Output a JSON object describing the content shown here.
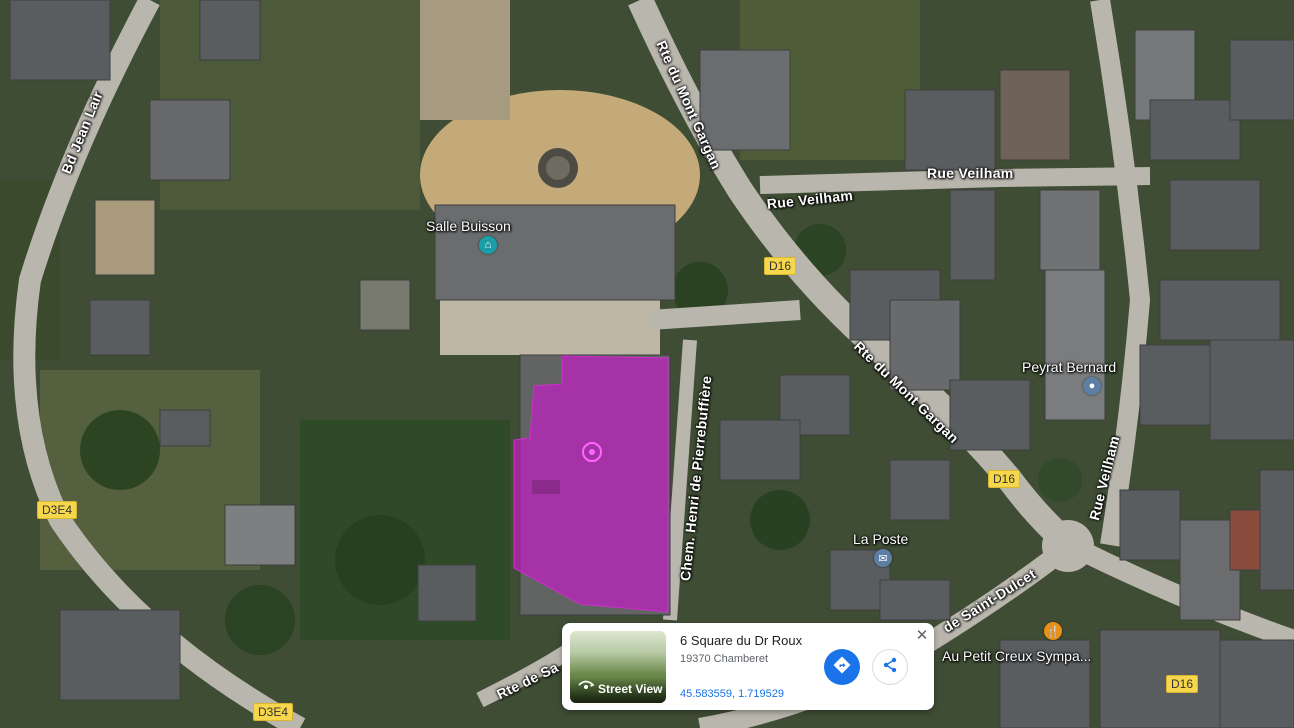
{
  "map": {
    "places": {
      "salle_buisson": "Salle Buisson",
      "peyrat_bernard": "Peyrat Bernard",
      "la_poste": "La Poste",
      "petit_creux": "Au Petit Creux Sympa..."
    },
    "roads": {
      "bd_jean_lair": "Bd Jean Lair",
      "mont_gargan_top": "Rte du Mont Gargan",
      "mont_gargan_mid": "Rte du Mont Gargan",
      "veilham_a": "Rue Veilham",
      "veilham_b": "Rue Veilham",
      "veilham_vertical": "Rue Veilham",
      "pierrebuffiere": "Chem. Henri de Pierrebuffière",
      "saint_dulcet": "de Saint-Dulcet",
      "rte_de_sa": "Rte de Sa"
    },
    "shields": {
      "d16_a": "D16",
      "d16_b": "D16",
      "d16_c": "D16",
      "d3e4_a": "D3E4",
      "d3e4_b": "D3E4"
    },
    "colors": {
      "selection": "#c01ec0",
      "pin_blue": "#5c7fa3",
      "pin_teal": "#1b9ea8",
      "pin_orange": "#e8901a"
    }
  },
  "card": {
    "title": "6 Square du Dr Roux",
    "subtitle": "19370 Chamberet",
    "coordinates": "45.583559, 1.719529",
    "street_view_label": "Street View",
    "icons": {
      "directions": "directions-icon",
      "share": "share-icon",
      "close": "close-icon",
      "street_view": "street-view-icon"
    }
  }
}
